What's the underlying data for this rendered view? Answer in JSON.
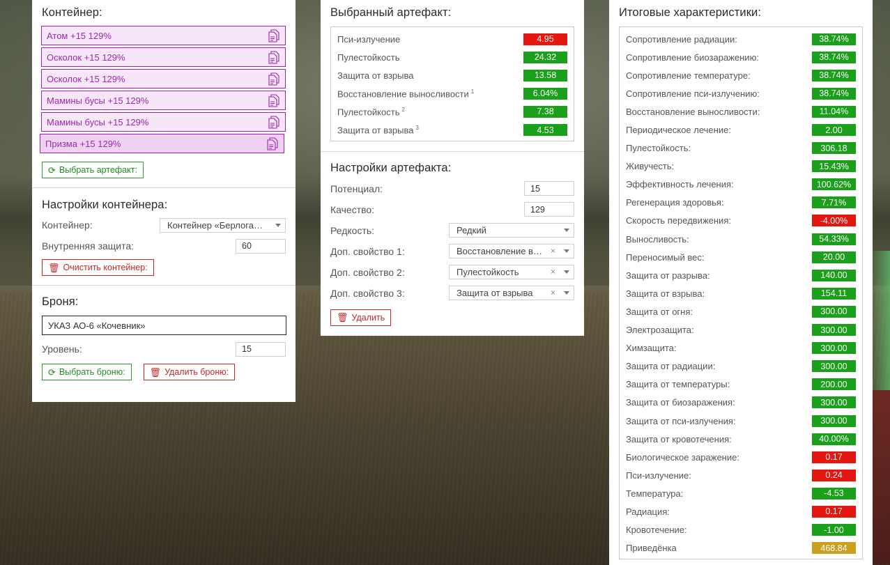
{
  "colors": {
    "positive": "#1aa01a",
    "negative": "#e3170f",
    "neutral": "#c9a11f",
    "accent": "#a020b8"
  },
  "container": {
    "title": "Контейнер:",
    "items": [
      {
        "label": "Атом +15 129%"
      },
      {
        "label": "Осколок +15 129%"
      },
      {
        "label": "Осколок +15 129%"
      },
      {
        "label": "Мамины бусы +15 129%"
      },
      {
        "label": "Мамины бусы +15 129%"
      },
      {
        "label": "Призма +15 129%"
      }
    ],
    "select_button": "Выбрать артефакт:"
  },
  "container_settings": {
    "title": "Настройки контейнера:",
    "container_label": "Контейнер:",
    "container_value": "Контейнер «Берлога…",
    "protection_label": "Внутренняя защита:",
    "protection_value": "60",
    "clear_button": "Очистить контейнер:"
  },
  "armor": {
    "title": "Броня:",
    "name": "УКАЗ АО-6 «Кочевник»",
    "level_label": "Уровень:",
    "level_value": "15",
    "select_button": "Выбрать броню:",
    "delete_button": "Удалить броню:"
  },
  "selected_artifact": {
    "title": "Выбранный артефакт:",
    "stats": [
      {
        "label": "Пси-излучение",
        "sup": "",
        "value": "4.95",
        "kind": "red"
      },
      {
        "label": "Пулестойкость",
        "sup": "",
        "value": "24.32",
        "kind": "green"
      },
      {
        "label": "Защита от взрыва",
        "sup": "",
        "value": "13.58",
        "kind": "green"
      },
      {
        "label": "Восстановление выносливости",
        "sup": "1",
        "value": "6.04%",
        "kind": "green"
      },
      {
        "label": "Пулестойкость",
        "sup": "2",
        "value": "7.38",
        "kind": "green"
      },
      {
        "label": "Защита от взрыва",
        "sup": "3",
        "value": "4.53",
        "kind": "green"
      }
    ]
  },
  "artifact_settings": {
    "title": "Настройки артефакта:",
    "potential_label": "Потенциал:",
    "potential_value": "15",
    "quality_label": "Качество:",
    "quality_value": "129",
    "rarity_label": "Редкость:",
    "rarity_value": "Редкий",
    "extra1_label": "Доп. свойство 1:",
    "extra1_value": "Восстановление в…",
    "extra2_label": "Доп. свойство 2:",
    "extra2_value": "Пулестойкость",
    "extra3_label": "Доп. свойство 3:",
    "extra3_value": "Защита от взрыва",
    "clear_glyph": "×",
    "delete_button": "Удалить"
  },
  "totals": {
    "title": "Итоговые характеристики:",
    "stats": [
      {
        "label": "Сопротивление радиации:",
        "value": "38.74%",
        "kind": "green"
      },
      {
        "label": "Сопротивление биозаражению:",
        "value": "38.74%",
        "kind": "green"
      },
      {
        "label": "Сопротивление температуре:",
        "value": "38.74%",
        "kind": "green"
      },
      {
        "label": "Сопротивление пси-излучению:",
        "value": "38.74%",
        "kind": "green"
      },
      {
        "label": "Восстановление выносливости:",
        "value": "11.04%",
        "kind": "green"
      },
      {
        "label": "Периодическое лечение:",
        "value": "2.00",
        "kind": "green"
      },
      {
        "label": "Пулестойкость:",
        "value": "306.18",
        "kind": "green"
      },
      {
        "label": "Живучесть:",
        "value": "15.43%",
        "kind": "green"
      },
      {
        "label": "Эффективность лечения:",
        "value": "100.62%",
        "kind": "green"
      },
      {
        "label": "Регенерация здоровья:",
        "value": "7.71%",
        "kind": "green"
      },
      {
        "label": "Скорость передвижения:",
        "value": "-4.00%",
        "kind": "red"
      },
      {
        "label": "Выносливость:",
        "value": "54.33%",
        "kind": "green"
      },
      {
        "label": "Переносимый вес:",
        "value": "20.00",
        "kind": "green"
      },
      {
        "label": "Защита от разрыва:",
        "value": "140.00",
        "kind": "green"
      },
      {
        "label": "Защита от взрыва:",
        "value": "154.11",
        "kind": "green"
      },
      {
        "label": "Защита от огня:",
        "value": "300.00",
        "kind": "green"
      },
      {
        "label": "Электрозащита:",
        "value": "300.00",
        "kind": "green"
      },
      {
        "label": "Химзащита:",
        "value": "300.00",
        "kind": "green"
      },
      {
        "label": "Защита от радиации:",
        "value": "300.00",
        "kind": "green"
      },
      {
        "label": "Защита от температуры:",
        "value": "200.00",
        "kind": "green"
      },
      {
        "label": "Защита от биозаражения:",
        "value": "300.00",
        "kind": "green"
      },
      {
        "label": "Защита от пси-излучения:",
        "value": "300.00",
        "kind": "green"
      },
      {
        "label": "Защита от кровотечения:",
        "value": "40.00%",
        "kind": "green"
      },
      {
        "label": "Биологическое заражение:",
        "value": "0.17",
        "kind": "red"
      },
      {
        "label": "Пси-излучение:",
        "value": "0.24",
        "kind": "red"
      },
      {
        "label": "Температура:",
        "value": "-4.53",
        "kind": "green"
      },
      {
        "label": "Радиация:",
        "value": "0.17",
        "kind": "red"
      },
      {
        "label": "Кровотечение:",
        "value": "-1.00",
        "kind": "green"
      },
      {
        "label": "Приведёнка",
        "value": "468.84",
        "kind": "gold"
      }
    ]
  }
}
